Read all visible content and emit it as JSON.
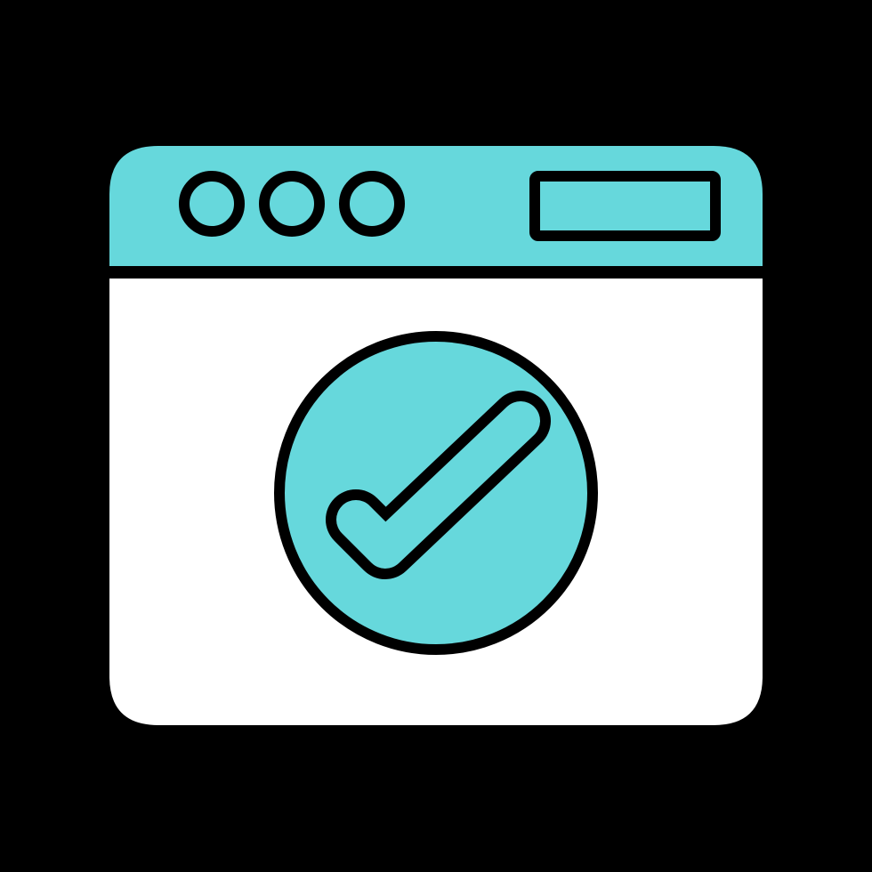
{
  "icon": {
    "name": "browser-window-check-icon",
    "colors": {
      "background": "#000000",
      "accent": "#66D8DC",
      "panel": "#FFFFFF",
      "outline": "#000000"
    },
    "parts": {
      "window_dots": [
        "dot-1-icon",
        "dot-2-icon",
        "dot-3-icon"
      ],
      "address_bar": "address-bar-rectangle",
      "status": "check-circle-icon"
    }
  }
}
